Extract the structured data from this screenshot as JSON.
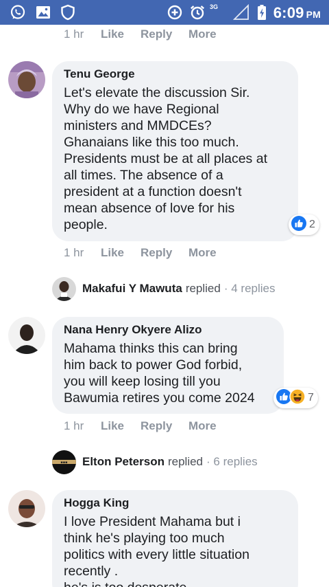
{
  "status_bar": {
    "network": "3G",
    "time": "6:09",
    "ampm": "PM",
    "icons": [
      "whatsapp-icon",
      "gallery-icon",
      "shield-icon",
      "data-saver-icon",
      "alarm-icon",
      "signal-icon",
      "battery-charging-icon"
    ]
  },
  "colors": {
    "brand": "#4267b2",
    "bubble": "#f0f2f5",
    "muted": "#8d949e"
  },
  "action_labels": {
    "like": "Like",
    "reply": "Reply",
    "more": "More"
  },
  "top_actions": {
    "time": "1 hr"
  },
  "comments": [
    {
      "author": "Tenu George",
      "text": "Let's elevate the discussion Sir.\nWhy do we have Regional\nministers and MMDCEs?\nGhanaians like this too much.\nPresidents must be at all places at\nall times. The absence of a\npresident at a function doesn't\nmean absence of love for his\npeople.",
      "reactions": {
        "count": "2",
        "icons": [
          "like-reaction-icon"
        ]
      },
      "time": "1 hr",
      "replies": {
        "name": "Makafui Y Mawuta",
        "word": "replied",
        "count": "· 4 replies"
      }
    },
    {
      "author": "Nana Henry Okyere Alizo",
      "text": "Mahama thinks this can bring\nhim back to power God forbid,\nyou will keep losing till you\nBawumia retires you come 2024",
      "reactions": {
        "count": "7",
        "icons": [
          "like-reaction-icon",
          "haha-reaction-icon"
        ]
      },
      "time": "1 hr",
      "replies": {
        "name": "Elton Peterson",
        "word": "replied",
        "count": "· 6 replies"
      }
    },
    {
      "author": "Hogga King",
      "text": "I love President Mahama but i\nthink he's playing too much\npolitics with every little situation\nrecently .\nhe's is too desperate"
    }
  ]
}
